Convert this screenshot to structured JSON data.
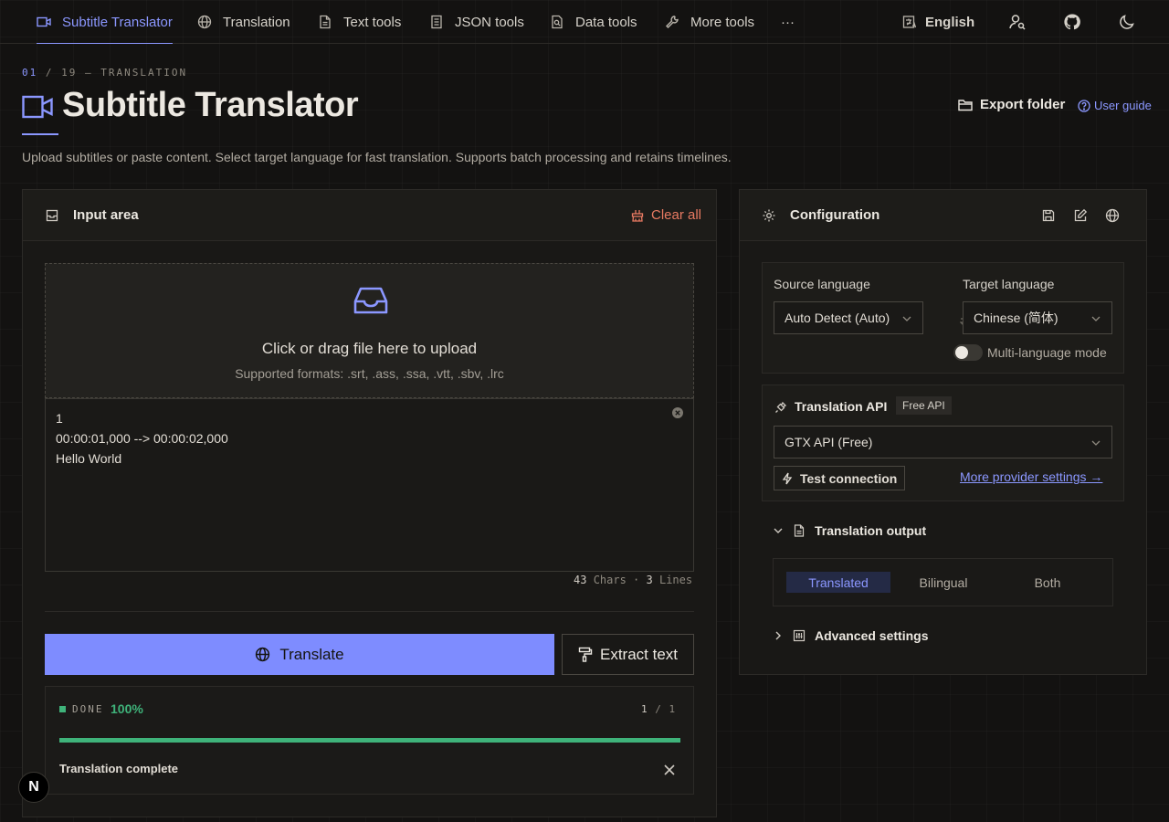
{
  "nav": {
    "items": [
      {
        "label": "Subtitle Translator",
        "icon": "video-icon",
        "active": true
      },
      {
        "label": "Translation",
        "icon": "globe-icon"
      },
      {
        "label": "Text tools",
        "icon": "document-icon"
      },
      {
        "label": "JSON tools",
        "icon": "json-icon"
      },
      {
        "label": "Data tools",
        "icon": "data-icon"
      },
      {
        "label": "More tools",
        "icon": "wrench-icon"
      }
    ],
    "more": "···",
    "language": "English"
  },
  "header": {
    "crumb_num": "01",
    "crumb_rest": "/ 19 — TRANSLATION",
    "title": "Subtitle Translator",
    "export_label": "Export folder",
    "guide_label": "User guide",
    "description": "Upload subtitles or paste content. Select target language for fast translation. Supports batch processing and retains timelines."
  },
  "input": {
    "title": "Input area",
    "clear_label": "Clear all",
    "upload_title": "Click or drag file here to upload",
    "upload_formats": "Supported formats: .srt, .ass, .ssa, .vtt, .sbv, .lrc",
    "content": "1\n00:00:01,000 --> 00:00:02,000\nHello World",
    "chars": "43",
    "chars_label": "Chars ·",
    "lines": "3",
    "lines_label": "Lines",
    "translate_label": "Translate",
    "extract_label": "Extract text"
  },
  "status": {
    "state": "DONE",
    "percent": "100%",
    "progress_value": 100,
    "done": "1",
    "sep": "/",
    "total": "1",
    "message": "Translation complete"
  },
  "config": {
    "title": "Configuration",
    "source_label": "Source language",
    "source_value": "Auto Detect (Auto)",
    "target_label": "Target language",
    "target_value": "Chinese (简体)",
    "multi_label": "Multi-language mode",
    "api_title": "Translation API",
    "api_badge": "Free API",
    "api_value": "GTX API (Free)",
    "test_label": "Test connection",
    "more_label": "More provider settings →",
    "output_title": "Translation output",
    "output_options": [
      "Translated",
      "Bilingual",
      "Both"
    ],
    "output_selected": "Translated",
    "advanced_title": "Advanced settings"
  },
  "colors": {
    "accent": "#8b97ff",
    "success": "#3fb37a",
    "danger": "#e87a62"
  }
}
